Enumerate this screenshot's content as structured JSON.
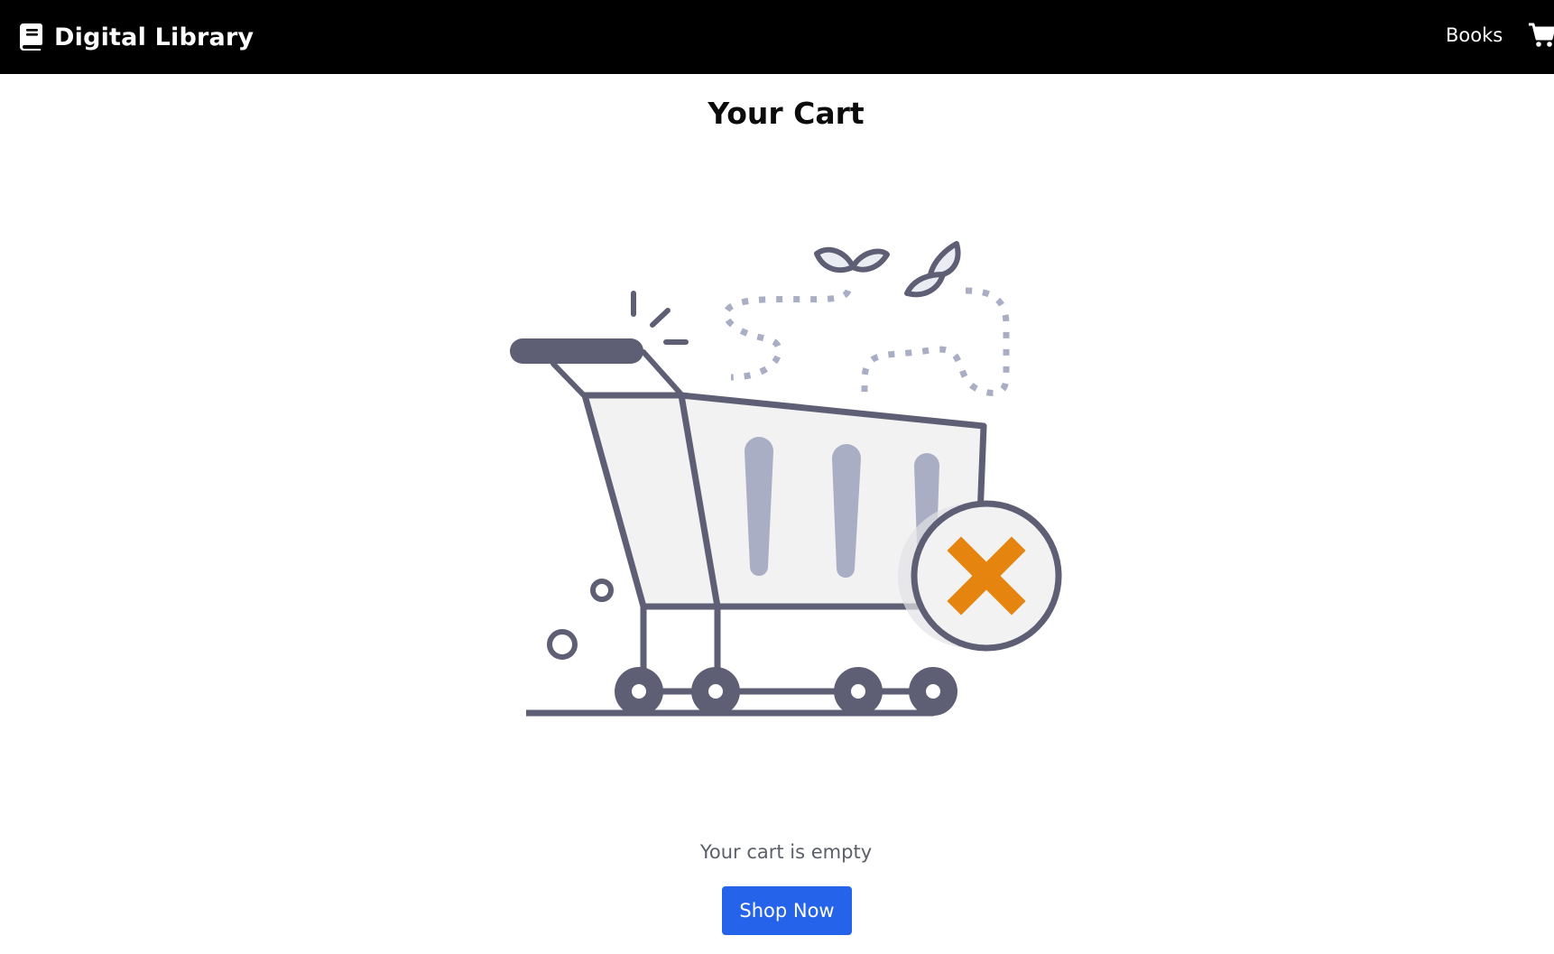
{
  "navbar": {
    "brand_title": "Digital Library",
    "brand_icon": "book-icon",
    "books_link": "Books",
    "cart_icon": "shopping-cart-icon",
    "background": "#000000"
  },
  "main": {
    "title": "Your Cart",
    "illustration": "empty-cart-illustration",
    "empty_message": "Your cart is empty",
    "shop_button_label": "Shop Now",
    "accent_color": "#2563eb",
    "x_mark_color": "#e5850f"
  }
}
